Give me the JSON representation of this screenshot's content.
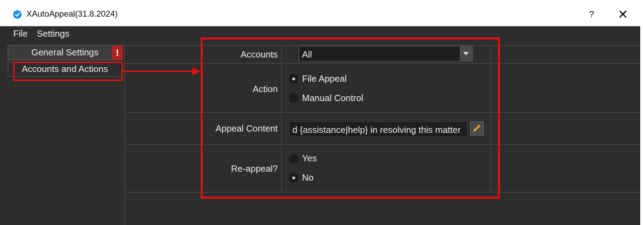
{
  "titlebar": {
    "title": "XAutoAppeal(31.8.2024)",
    "icon": "shield-check-icon",
    "help_label": "?",
    "close_label": "✕"
  },
  "menu": {
    "file": "File",
    "settings": "Settings"
  },
  "sidebar": {
    "general_settings": "General Settings",
    "warning_badge": "!",
    "accounts_and_actions": "Accounts and Actions"
  },
  "form": {
    "accounts_label": "Accounts",
    "accounts_value": "All",
    "action_label": "Action",
    "action_options": [
      "File Appeal",
      "Manual Control"
    ],
    "action_selected": "File Appeal",
    "appeal_content_label": "Appeal Content",
    "appeal_content_value": "d {assistance|help} in resolving this matter",
    "reappeal_label": "Re-appeal?",
    "reappeal_options": [
      "Yes",
      "No"
    ],
    "reappeal_selected": "No"
  },
  "colors": {
    "background": "#2d2d2d",
    "annotation": "#e01010",
    "edit_icon": "#f0a030"
  }
}
